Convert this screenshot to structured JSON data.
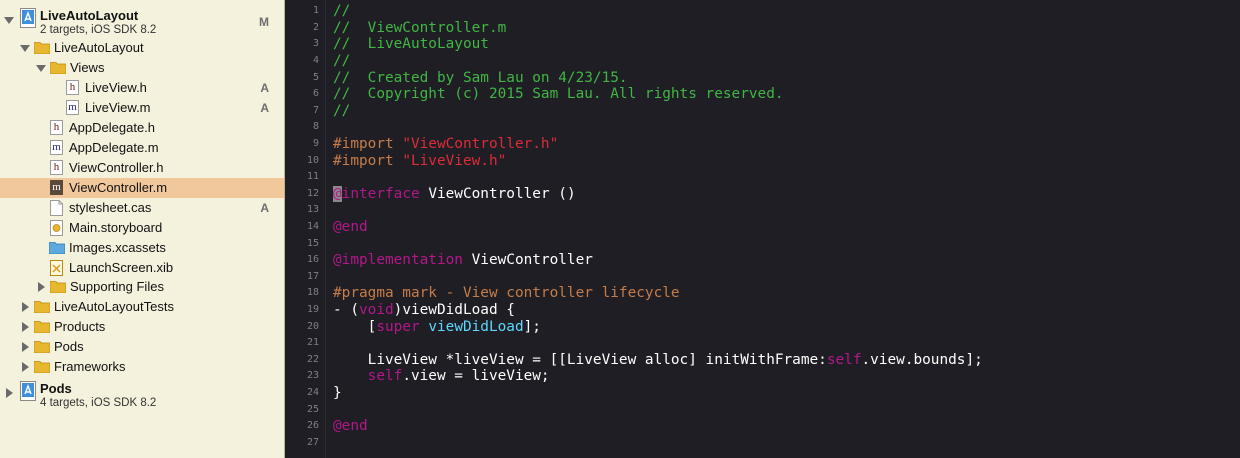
{
  "navigator": {
    "rows": [
      {
        "name": "LiveAutoLayout",
        "sub": "2 targets, iOS SDK 8.2",
        "status": "M"
      },
      {
        "name": "LiveAutoLayout",
        "status": ""
      },
      {
        "name": "Views",
        "status": ""
      },
      {
        "name": "LiveView.h",
        "glyph": "h",
        "status": "A"
      },
      {
        "name": "LiveView.m",
        "glyph": "m",
        "status": "A"
      },
      {
        "name": "AppDelegate.h",
        "glyph": "h",
        "status": ""
      },
      {
        "name": "AppDelegate.m",
        "glyph": "m",
        "status": ""
      },
      {
        "name": "ViewController.h",
        "glyph": "h",
        "status": ""
      },
      {
        "name": "ViewController.m",
        "glyph": "m",
        "status": ""
      },
      {
        "name": "stylesheet.cas",
        "status": "A"
      },
      {
        "name": "Main.storyboard",
        "status": ""
      },
      {
        "name": "Images.xcassets",
        "status": ""
      },
      {
        "name": "LaunchScreen.xib",
        "status": ""
      },
      {
        "name": "Supporting Files",
        "status": ""
      },
      {
        "name": "LiveAutoLayoutTests",
        "status": ""
      },
      {
        "name": "Products",
        "status": ""
      },
      {
        "name": "Pods",
        "status": ""
      },
      {
        "name": "Frameworks",
        "status": ""
      },
      {
        "name": "Pods",
        "sub": "4 targets, iOS SDK 8.2",
        "status": ""
      }
    ]
  },
  "editor": {
    "line_numbers": [
      "1",
      "2",
      "3",
      "4",
      "5",
      "6",
      "7",
      "8",
      "9",
      "10",
      "11",
      "12",
      "13",
      "14",
      "15",
      "16",
      "17",
      "18",
      "19",
      "20",
      "21",
      "22",
      "23",
      "24",
      "25",
      "26",
      "27"
    ],
    "code": {
      "l1": "//",
      "l2": "//  ViewController.m",
      "l3": "//  LiveAutoLayout",
      "l4": "//",
      "l5": "//  Created by Sam Lau on 4/23/15.",
      "l6": "//  Copyright (c) 2015 Sam Lau. All rights reserved.",
      "l7": "//",
      "l9_kw": "#import ",
      "l9_str": "\"ViewController.h\"",
      "l10_kw": "#import ",
      "l10_str": "\"LiveView.h\"",
      "l12_caret": "@",
      "l12_kw": "interface",
      "l12_rest": " ViewController ()",
      "l14": "@end",
      "l16_kw": "@implementation",
      "l16_rest": " ViewController",
      "l18": "#pragma mark - View controller lifecycle",
      "l19_a": "- (",
      "l19_kw": "void",
      "l19_b": ")viewDidLoad {",
      "l20_a": "    [",
      "l20_kw": "super",
      "l20_sp": " ",
      "l20_cls": "viewDidLoad",
      "l20_b": "];",
      "l22_a": "    LiveView *liveView = [[LiveView alloc] initWithFrame:",
      "l22_kw": "self",
      "l22_b": ".view.bounds];",
      "l23_kw": "    self",
      "l23_b": ".view = liveView;",
      "l24": "}",
      "l26": "@end"
    }
  }
}
